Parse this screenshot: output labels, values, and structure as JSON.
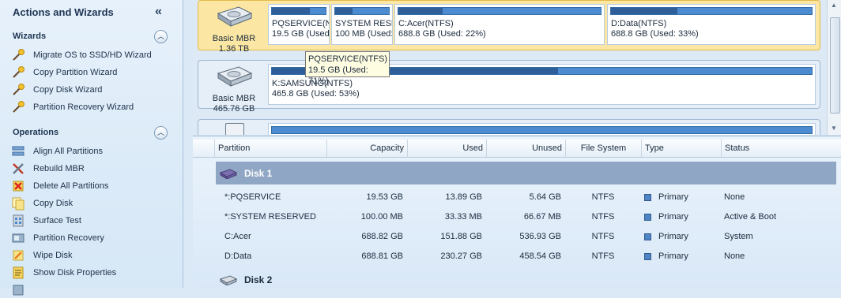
{
  "sidebar": {
    "title": "Actions and Wizards",
    "wizards_title": "Wizards",
    "wizards": [
      {
        "label": "Migrate OS to SSD/HD Wizard",
        "icon": "wand-icon"
      },
      {
        "label": "Copy Partition Wizard",
        "icon": "wand-icon"
      },
      {
        "label": "Copy Disk Wizard",
        "icon": "wand-icon"
      },
      {
        "label": "Partition Recovery Wizard",
        "icon": "wand-icon"
      }
    ],
    "operations_title": "Operations",
    "operations": [
      {
        "label": "Align All Partitions",
        "icon": "align-icon"
      },
      {
        "label": "Rebuild MBR",
        "icon": "tools-icon"
      },
      {
        "label": "Delete All Partitions",
        "icon": "delete-icon"
      },
      {
        "label": "Copy Disk",
        "icon": "copy-icon"
      },
      {
        "label": "Surface Test",
        "icon": "surface-test-icon"
      },
      {
        "label": "Partition Recovery",
        "icon": "recovery-icon"
      },
      {
        "label": "Wipe Disk",
        "icon": "wipe-icon"
      },
      {
        "label": "Show Disk Properties",
        "icon": "properties-icon"
      }
    ]
  },
  "disk_map": {
    "disks": [
      {
        "type_label": "Basic MBR",
        "size": "1.36 TB",
        "partitions": [
          {
            "name": "PQSERVICE(NT",
            "info": "19.5 GB (Used",
            "used": 0.71
          },
          {
            "name": "SYSTEM RESER",
            "info": "100 MB (Used:",
            "used": 0.33
          },
          {
            "name": "C:Acer(NTFS)",
            "info": "688.8 GB (Used: 22%)",
            "used": 0.22
          },
          {
            "name": "D:Data(NTFS)",
            "info": "688.8 GB (Used: 33%)",
            "used": 0.33
          }
        ]
      },
      {
        "type_label": "Basic MBR",
        "size": "465.76 GB",
        "partitions": [
          {
            "name": "K:SAMSUNG(NTFS)",
            "info": "465.8 GB (Used: 53%)",
            "used": 0.53
          }
        ]
      }
    ],
    "tooltip": {
      "line1": "PQSERVICE(NTFS)",
      "line2": "19.5 GB (Used: 71%)"
    }
  },
  "table": {
    "columns": [
      "Partition",
      "Capacity",
      "Used",
      "Unused",
      "File System",
      "Type",
      "Status"
    ],
    "disk1_label": "Disk 1",
    "disk2_label": "Disk 2",
    "rows": [
      {
        "partition": "*:PQSERVICE",
        "capacity": "19.53 GB",
        "used": "13.89 GB",
        "unused": "5.64 GB",
        "fs": "NTFS",
        "type": "Primary",
        "status": "None"
      },
      {
        "partition": "*:SYSTEM RESERVED",
        "capacity": "100.00 MB",
        "used": "33.33 MB",
        "unused": "66.67 MB",
        "fs": "NTFS",
        "type": "Primary",
        "status": "Active & Boot"
      },
      {
        "partition": "C:Acer",
        "capacity": "688.82 GB",
        "used": "151.88 GB",
        "unused": "536.93 GB",
        "fs": "NTFS",
        "type": "Primary",
        "status": "System"
      },
      {
        "partition": "D:Data",
        "capacity": "688.81 GB",
        "used": "230.27 GB",
        "unused": "458.54 GB",
        "fs": "NTFS",
        "type": "Primary",
        "status": "None"
      }
    ]
  },
  "colors": {
    "selected_disk": "#fbe6a3",
    "selected_row": "#8fa6c4",
    "bar": "#4d8bd0",
    "primary_box": "#4e84c4"
  }
}
